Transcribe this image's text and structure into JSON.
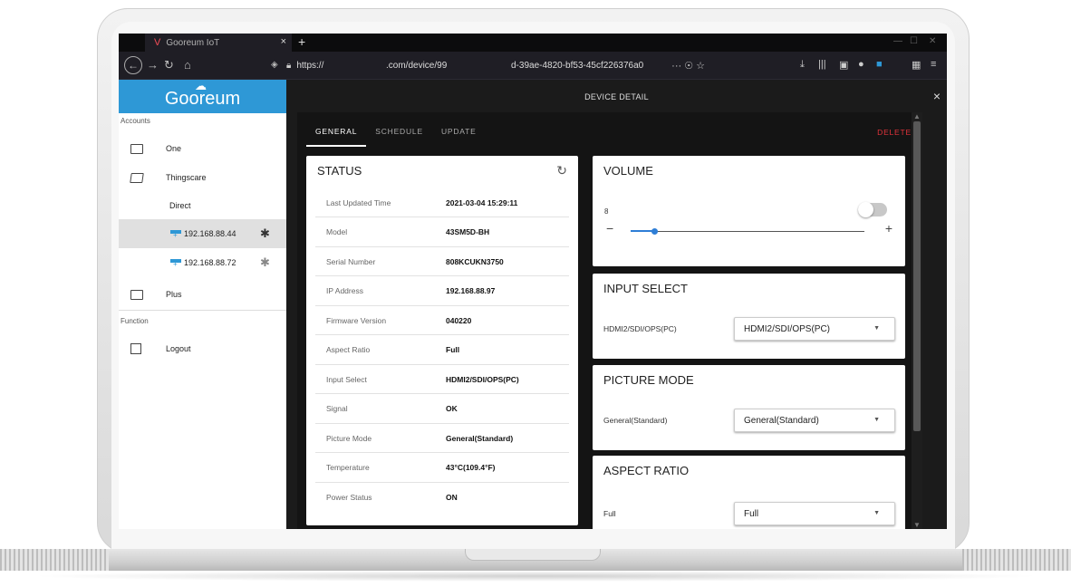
{
  "browser": {
    "tab_title": "Gooreum IoT",
    "tab_close": "×",
    "new_tab": "+",
    "url_part1": "https://",
    "url_part2": ".com/device/99",
    "url_part3": "d-39ae-4820-bf53-45cf226376a0",
    "url_tools": "···  ☉  ☆",
    "toolbar_icons": [
      "download-icon",
      "library-icon",
      "reader-icon",
      "account-icon",
      "extension-icon",
      "menu-icon"
    ]
  },
  "app": {
    "brand": "Gooreum",
    "sidebar": {
      "accounts_label": "Accounts",
      "items": [
        {
          "label": "One"
        },
        {
          "label": "Thingscare"
        },
        {
          "label": "Direct"
        },
        {
          "label": "192.168.88.44"
        },
        {
          "label": "192.168.88.72"
        },
        {
          "label": "Plus"
        }
      ],
      "function_label": "Function",
      "logout_label": "Logout"
    },
    "header": {
      "title": "DEVICE DETAIL",
      "close": "×"
    },
    "tabs": [
      "GENERAL",
      "SCHEDULE",
      "UPDATE"
    ],
    "active_tab": "GENERAL",
    "delete_label": "DELETE",
    "status": {
      "title": "STATUS",
      "rows": [
        {
          "key": "Last Updated Time",
          "value": "2021-03-04 15:29:11"
        },
        {
          "key": "Model",
          "value": "43SM5D-BH"
        },
        {
          "key": "Serial Number",
          "value": "808KCUKN3750"
        },
        {
          "key": "IP Address",
          "value": "192.168.88.97"
        },
        {
          "key": "Firmware Version",
          "value": "040220"
        },
        {
          "key": "Aspect Ratio",
          "value": "Full"
        },
        {
          "key": "Input Select",
          "value": "HDMI2/SDI/OPS(PC)"
        },
        {
          "key": "Signal",
          "value": "OK"
        },
        {
          "key": "Picture Mode",
          "value": "General(Standard)"
        },
        {
          "key": "Temperature",
          "value": "43°C(109.4°F)"
        },
        {
          "key": "Power Status",
          "value": "ON"
        }
      ]
    },
    "volume": {
      "title": "VOLUME",
      "level": "8",
      "min_label": "−",
      "max_label": "+",
      "slider_fraction": 0.1,
      "mute_toggle_on": false
    },
    "input_select": {
      "title": "INPUT SELECT",
      "label": "HDMI2/SDI/OPS(PC)",
      "selected": "HDMI2/SDI/OPS(PC)"
    },
    "picture_mode": {
      "title": "PICTURE MODE",
      "label": "General(Standard)",
      "selected": "General(Standard)"
    },
    "aspect_ratio": {
      "title": "ASPECT RATIO",
      "label": "Full",
      "selected": "Full"
    },
    "colors": {
      "brand": "#2e98d6",
      "delete": "#e2333b",
      "slider": "#2e7ed6"
    }
  }
}
